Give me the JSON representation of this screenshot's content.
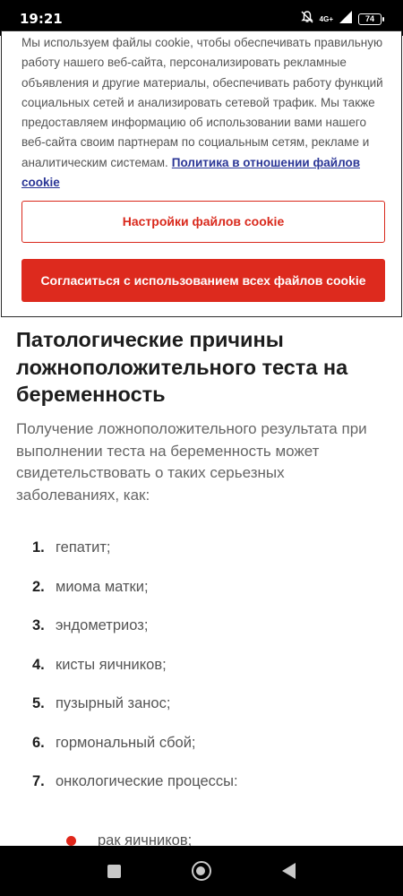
{
  "status_bar": {
    "time": "19:21",
    "network": "4G+",
    "battery": "74",
    "icons": [
      "mute-bell-icon",
      "signal-icon",
      "battery-icon"
    ]
  },
  "cookie": {
    "text": "Мы используем файлы cookie, чтобы обеспечивать правильную работу нашего веб-сайта, персонализировать рекламные объявления и другие материалы, обеспечивать работу функций социальных сетей и анализировать сетевой трафик. Мы также предоставляем информацию об использовании вами нашего веб-сайта своим партнерам по социальным сетям, рекламе и аналитическим системам.",
    "link": "Политика в отношении файлов cookie",
    "settings_button": "Настройки файлов cookie",
    "accept_button": "Согласиться с использованием всех файлов cookie",
    "accent_color": "#dd2a1e"
  },
  "article": {
    "title": "Патологические причины ложноположительного теста на беременность",
    "intro": "Получение ложноположительного результата при выполнении теста на беременность может свидетельствовать о таких серьезных заболеваниях, как:",
    "items": [
      {
        "num": "1.",
        "text": "гепатит;"
      },
      {
        "num": "2.",
        "text": "миома матки;"
      },
      {
        "num": "3.",
        "text": "эндометриоз;"
      },
      {
        "num": "4.",
        "text": "кисты яичников;"
      },
      {
        "num": "5.",
        "text": "пузырный занос;"
      },
      {
        "num": "6.",
        "text": "гормональный сбой;"
      },
      {
        "num": "7.",
        "text": "онкологические процессы:"
      }
    ],
    "sub_item": "рак яичников;"
  },
  "nav_bar": {
    "icons": [
      "recents-square-icon",
      "home-circle-icon",
      "back-triangle-icon"
    ]
  }
}
